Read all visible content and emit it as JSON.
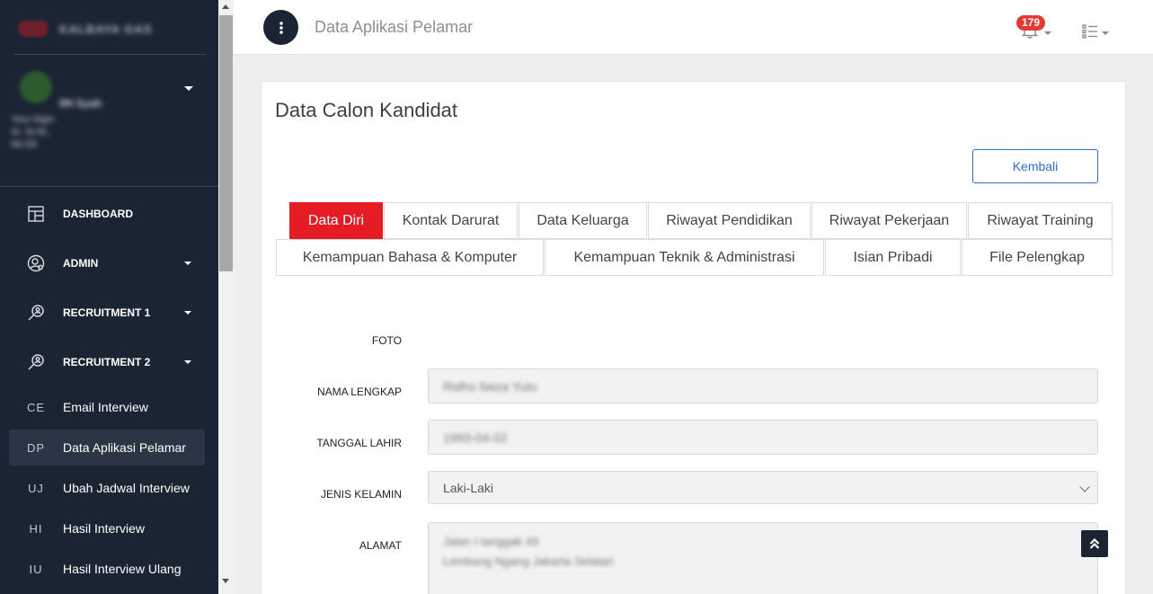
{
  "sidebar": {
    "brand_text": "KALBAYA GAS",
    "user": {
      "name": "IIN Syah",
      "info": "Your lógin\nSi. St.fd.,\nlW.Gll"
    },
    "menu": [
      {
        "label": "DASHBOARD",
        "icon": "dashboard-icon",
        "has_caret": false
      },
      {
        "label": "ADMIN",
        "icon": "user-gear-icon",
        "has_caret": true
      },
      {
        "label": "RECRUITMENT 1",
        "icon": "search-person-icon",
        "has_caret": true
      },
      {
        "label": "RECRUITMENT 2",
        "icon": "search-person-icon",
        "has_caret": true
      }
    ],
    "sub_items": [
      {
        "abbr": "CE",
        "label": "Email Interview"
      },
      {
        "abbr": "DP",
        "label": "Data Aplikasi Pelamar"
      },
      {
        "abbr": "UJ",
        "label": "Ubah Jadwal Interview"
      },
      {
        "abbr": "HI",
        "label": "Hasil Interview"
      },
      {
        "abbr": "IU",
        "label": "Hasil Interview Ulang"
      }
    ]
  },
  "topbar": {
    "title": "Data Aplikasi Pelamar",
    "notification_count": "179"
  },
  "card": {
    "title": "Data Calon Kandidat",
    "back_button": "Kembali",
    "tabs_row1": [
      "Data Diri",
      "Kontak Darurat",
      "Data Keluarga",
      "Riwayat Pendidikan",
      "Riwayat Pekerjaan",
      "Riwayat Training"
    ],
    "tabs_row2": [
      "Kemampuan Bahasa & Komputer",
      "Kemampuan Teknik & Administrasi",
      "Isian Pribadi",
      "File Pelengkap"
    ],
    "active_tab": "Data Diri",
    "form": {
      "foto_label": "FOTO",
      "nama_label": "NAMA LENGKAP",
      "nama_value": "Ridho Ilaiza Yutu",
      "tanggal_label": "TANGGAL LAHIR",
      "tanggal_value": "1993-04-02",
      "jenis_label": "JENIS KELAMIN",
      "jenis_value": "Laki-Laki",
      "alamat_label": "ALAMAT",
      "alamat_line1": "Jalan I tanggak 49",
      "alamat_line2": "Lembang Ngang Jakarta Selatan"
    }
  },
  "colors": {
    "sidebar_bg": "#1b2433",
    "active_tab": "#e51c23",
    "accent_blue": "#2f6dc2",
    "badge": "#e53935"
  }
}
